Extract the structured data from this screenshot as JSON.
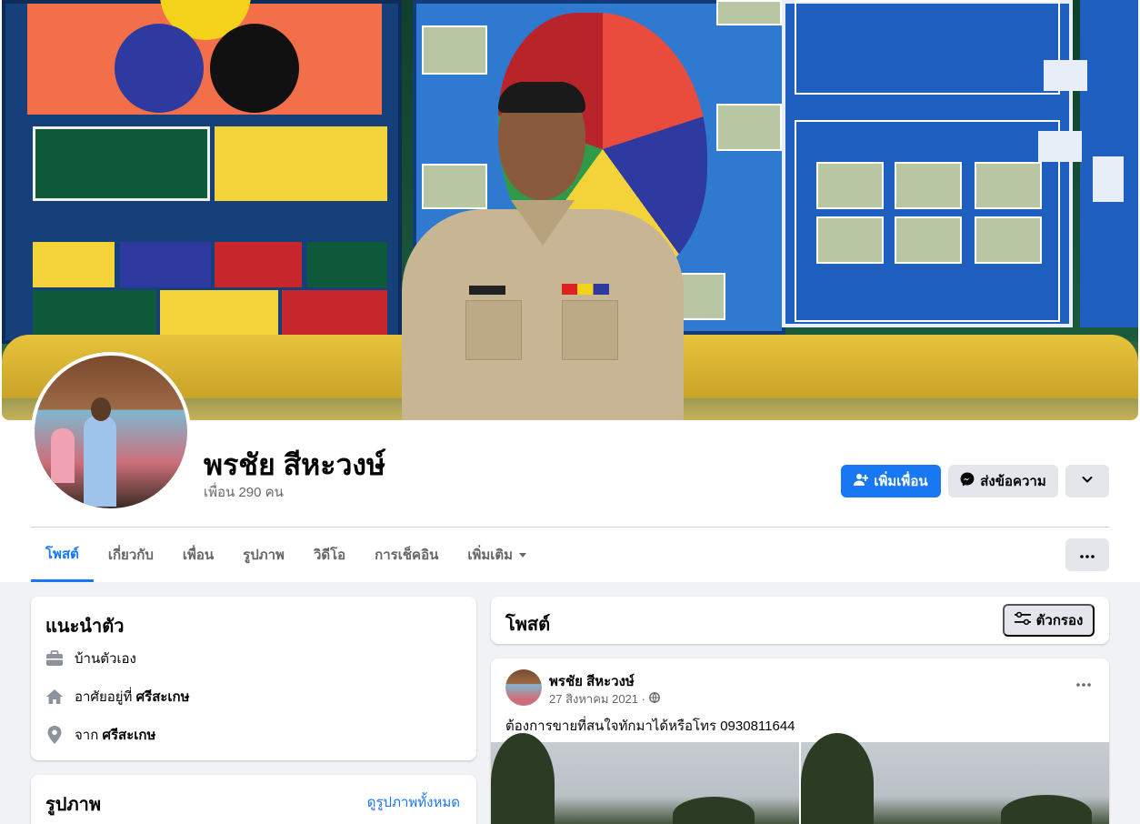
{
  "profile": {
    "name": "พรชัย สีหะวงษ์",
    "friends": "เพื่อน 290 คน"
  },
  "actions": {
    "add_friend": "เพิ่มเพื่อน",
    "message": "ส่งข้อความ"
  },
  "tabs": [
    {
      "label": "โพสต์"
    },
    {
      "label": "เกี่ยวกับ"
    },
    {
      "label": "เพื่อน"
    },
    {
      "label": "รูปภาพ"
    },
    {
      "label": "วิดีโอ"
    },
    {
      "label": "การเช็คอิน"
    },
    {
      "label": "เพิ่มเติม"
    }
  ],
  "intro": {
    "title": "แนะนำตัว",
    "rows": [
      {
        "icon": "briefcase-icon",
        "text": "บ้านตัวเอง",
        "bold": ""
      },
      {
        "icon": "home-icon",
        "text": "อาศัยอยู่ที่ ",
        "bold": "ศรีสะเกษ"
      },
      {
        "icon": "location-pin-icon",
        "text": "จาก ",
        "bold": "ศรีสะเกษ"
      }
    ]
  },
  "photos": {
    "title": "รูปภาพ",
    "see_all": "ดูรูปภาพทั้งหมด"
  },
  "posts": {
    "title": "โพสต์",
    "filter": "ตัวกรอง"
  },
  "post": {
    "author": "พรชัย สีหะวงษ์",
    "date": "27 สิงหาคม 2021 ·",
    "text": "ต้องการขายที่สนใจทักมาได้หรือโทร 0930811644"
  },
  "colors": {
    "accent": "#1877f2",
    "background": "#f0f2f5",
    "secondary_button": "#e4e6eb",
    "muted_text": "#65676b"
  }
}
